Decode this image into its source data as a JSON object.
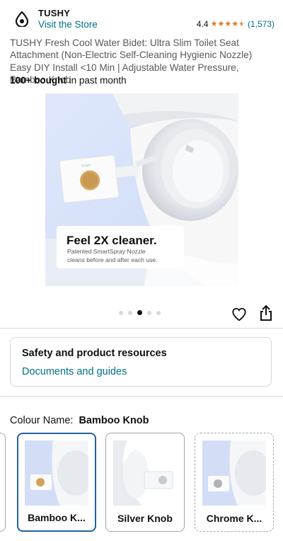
{
  "header": {
    "brand": "TUSHY",
    "store_link": "Visit the Store",
    "rating_value": "4.4",
    "rating_count": "(1,573)",
    "star_color": "#de7921"
  },
  "product": {
    "title": "TUSHY Fresh Cool Water Bidet: Ultra Slim Toilet Seat Attachment (Non-Electric Self-Cleaning Hygienic Nozzle) Easy DIY Install <10 Min | Adjustable Water Pressure, Bamboo Knob",
    "bought_count": "100+ bought",
    "bought_suffix": " in past month"
  },
  "hero": {
    "headline": "Feel 2X cleaner.",
    "subline1": "Patented SmartSpray Nozzle",
    "subline2": "cleans before and after each use.",
    "device_brand": "TUSHY",
    "background": "#d7e3fb"
  },
  "carousel": {
    "dot_count": 5,
    "active_index": 2
  },
  "actions": {
    "like_icon": "heart-icon",
    "share_icon": "share-icon"
  },
  "resources": {
    "title": "Safety and product resources",
    "link": "Documents and guides"
  },
  "colour": {
    "label": "Colour Name:",
    "selected": "Bamboo Knob",
    "options": [
      {
        "label": "Bamboo K...",
        "selected": true
      },
      {
        "label": "Silver Knob",
        "selected": false
      },
      {
        "label": "Chrome K...",
        "selected": false
      }
    ]
  },
  "colors": {
    "link": "#007185",
    "selected_border": "#2162a1",
    "text": "#0f1111"
  }
}
